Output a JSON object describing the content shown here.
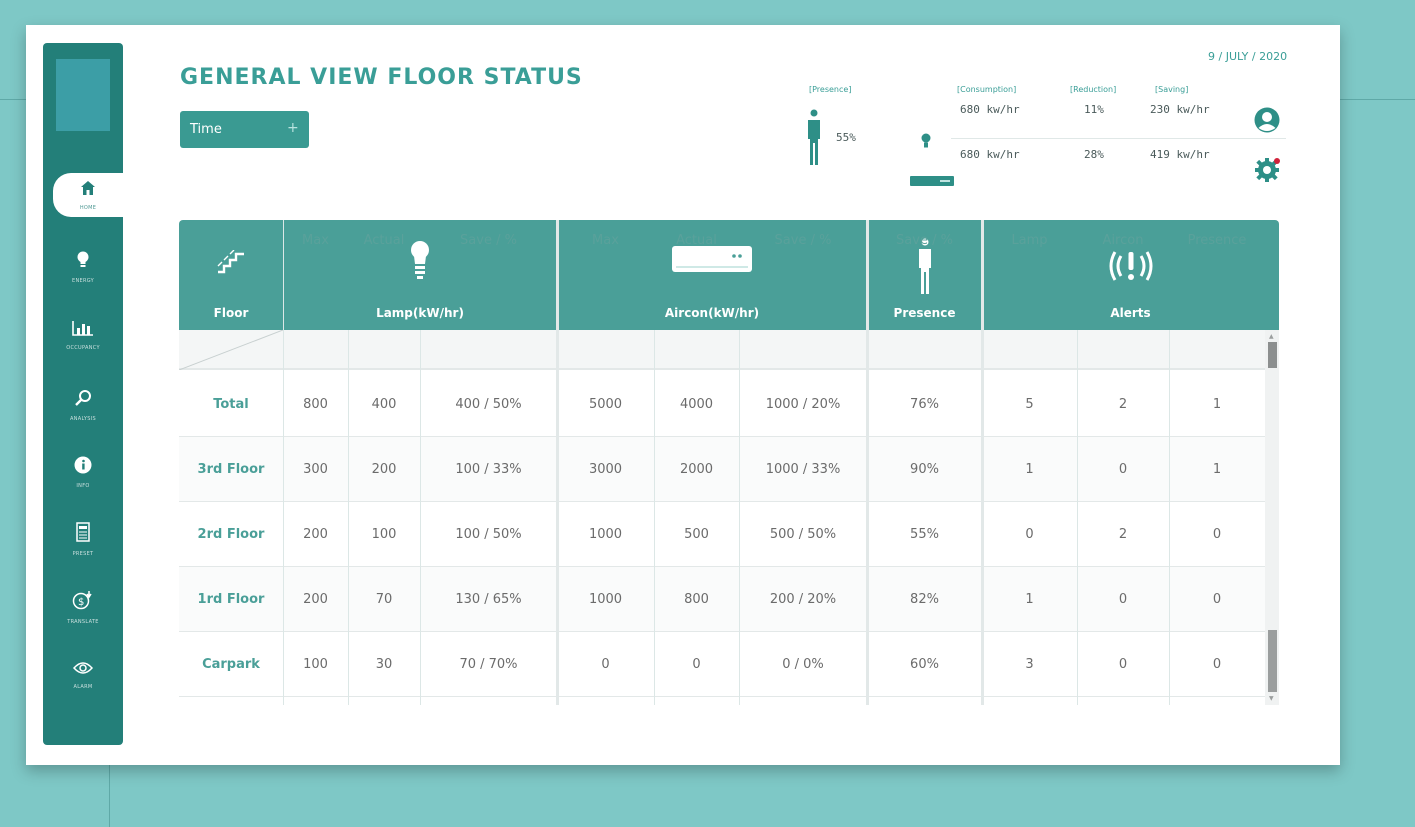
{
  "header": {
    "title": "GENERAL VIEW FLOOR STATUS",
    "date": "9 / JULY / 2020",
    "time_button": {
      "label": "Time",
      "plus": "+"
    }
  },
  "sidebar": {
    "items": [
      {
        "label": "HOME",
        "icon": "home-icon",
        "active": true
      },
      {
        "label": "ENERGY",
        "icon": "bulb-icon"
      },
      {
        "label": "OCCUPANCY",
        "icon": "bar-chart-icon"
      },
      {
        "label": "ANALYSIS",
        "icon": "search-icon"
      },
      {
        "label": "INFO",
        "icon": "info-icon"
      },
      {
        "label": "PRESET",
        "icon": "document-icon"
      },
      {
        "label": "TRANSLATE",
        "icon": "money-icon"
      },
      {
        "label": "ALARM",
        "icon": "eye-icon"
      }
    ]
  },
  "summary": {
    "presence_label": "[Presence]",
    "presence_value": "55%",
    "consumption_label": "[Consumption]",
    "reduction_label": "[Reduction]",
    "saving_label": "[Saving]",
    "lamp": {
      "consumption": "680 kw/hr",
      "reduction": "11%",
      "saving": "230 kw/hr"
    },
    "aircon": {
      "consumption": "680 kw/hr",
      "reduction": "28%",
      "saving": "419 kw/hr"
    }
  },
  "table": {
    "groups": {
      "floor": "Floor",
      "lamp": "Lamp(kW/hr)",
      "aircon": "Aircon(kW/hr)",
      "presence": "Presence",
      "alerts": "Alerts"
    },
    "subheaders": [
      "Max",
      "Actual",
      "Save / %",
      "Max",
      "Actual",
      "Save / %",
      "Save / %",
      "Lamp",
      "Aircon",
      "Presence"
    ],
    "rows": [
      {
        "floor": "Total",
        "cells": [
          "800",
          "400",
          "400 / 50%",
          "5000",
          "4000",
          "1000 / 20%",
          "76%",
          "5",
          "2",
          "1"
        ]
      },
      {
        "floor": "3rd Floor",
        "cells": [
          "300",
          "200",
          "100 / 33%",
          "3000",
          "2000",
          "1000 / 33%",
          "90%",
          "1",
          "0",
          "1"
        ]
      },
      {
        "floor": "2rd Floor",
        "cells": [
          "200",
          "100",
          "100 / 50%",
          "1000",
          "500",
          "500 / 50%",
          "55%",
          "0",
          "2",
          "0"
        ]
      },
      {
        "floor": "1rd Floor",
        "cells": [
          "200",
          "70",
          "130 / 65%",
          "1000",
          "800",
          "200 / 20%",
          "82%",
          "1",
          "0",
          "0"
        ]
      },
      {
        "floor": "Carpark",
        "cells": [
          "100",
          "30",
          "70 / 70%",
          "0",
          "0",
          "0 / 0%",
          "60%",
          "3",
          "0",
          "0"
        ]
      }
    ]
  },
  "colors": {
    "accent": "#3a9e97",
    "sidebar": "#237f79",
    "table_header": "#4a9f98",
    "background": "#7ec8c6",
    "alert_dot": "#d0223a"
  }
}
